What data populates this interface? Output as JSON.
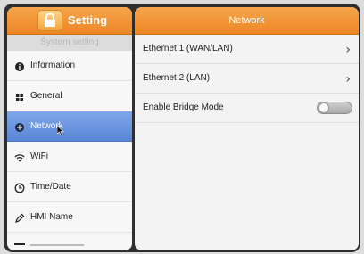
{
  "colors": {
    "header_orange": "#ec8624",
    "active_blue": "#5a86d6",
    "frame": "#2f2f2f"
  },
  "sidebar": {
    "title": "Setting",
    "section": "System setting",
    "items": [
      {
        "label": "Information",
        "icon": "info-icon",
        "active": false
      },
      {
        "label": "General",
        "icon": "grid-icon",
        "active": false
      },
      {
        "label": "Network",
        "icon": "network-icon",
        "active": true
      },
      {
        "label": "WiFi",
        "icon": "wifi-icon",
        "active": false
      },
      {
        "label": "Time/Date",
        "icon": "clock-icon",
        "active": false
      },
      {
        "label": "HMI Name",
        "icon": "pen-icon",
        "active": false
      }
    ]
  },
  "main": {
    "title": "Network",
    "rows": [
      {
        "label": "Ethernet 1 (WAN/LAN)",
        "type": "nav"
      },
      {
        "label": "Ethernet 2 (LAN)",
        "type": "nav"
      },
      {
        "label": "Enable Bridge Mode",
        "type": "toggle",
        "on": false
      }
    ]
  }
}
